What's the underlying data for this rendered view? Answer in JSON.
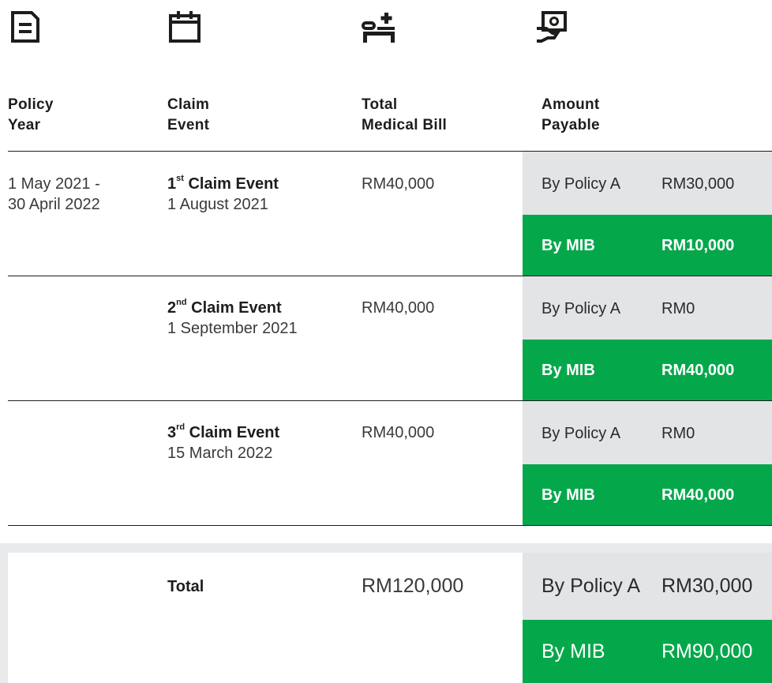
{
  "icons": [
    {
      "name": "document-icon"
    },
    {
      "name": "calendar-icon"
    },
    {
      "name": "hospital-bed-icon"
    },
    {
      "name": "payment-hand-icon"
    }
  ],
  "headers": {
    "policy_year_line1": "Policy",
    "policy_year_line2": "Year",
    "claim_event_line1": "Claim",
    "claim_event_line2": "Event",
    "medical_bill_line1": "Total",
    "medical_bill_line2": "Medical Bill",
    "amount_payable_line1": "Amount",
    "amount_payable_line2": "Payable"
  },
  "rows": [
    {
      "policy_year_line1": "1 May 2021 -",
      "policy_year_line2": "30 April 2022",
      "event_num": "1",
      "event_suffix": "st",
      "event_label": " Claim Event",
      "event_date": "1 August 2021",
      "medical_bill": "RM40,000",
      "policy_label": "By Policy A",
      "policy_amount": "RM30,000",
      "mib_label": "By MIB",
      "mib_amount": "RM10,000"
    },
    {
      "policy_year_line1": "",
      "policy_year_line2": "",
      "event_num": "2",
      "event_suffix": "nd",
      "event_label": " Claim Event",
      "event_date": "1 September 2021",
      "medical_bill": "RM40,000",
      "policy_label": "By Policy A",
      "policy_amount": "RM0",
      "mib_label": "By MIB",
      "mib_amount": "RM40,000"
    },
    {
      "policy_year_line1": "",
      "policy_year_line2": "",
      "event_num": "3",
      "event_suffix": "rd",
      "event_label": " Claim Event",
      "event_date": "15 March 2022",
      "medical_bill": "RM40,000",
      "policy_label": "By Policy A",
      "policy_amount": "RM0",
      "mib_label": "By MIB",
      "mib_amount": "RM40,000"
    }
  ],
  "total": {
    "label": "Total",
    "medical_bill": "RM120,000",
    "policy_label": "By Policy A",
    "policy_amount": "RM30,000",
    "mib_label": "By MIB",
    "mib_amount": "RM90,000"
  },
  "colors": {
    "green": "#04a84b",
    "grey": "#e3e4e6",
    "text": "#1d1d1b"
  }
}
